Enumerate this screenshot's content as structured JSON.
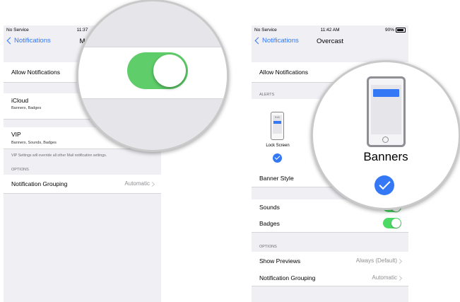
{
  "left": {
    "status": {
      "carrier": "No Service",
      "time": "11:37"
    },
    "nav": {
      "back_label": "Notifications",
      "title": "M"
    },
    "rows": {
      "allow_notifications": "Allow Notifications",
      "icloud": {
        "label": "iCloud",
        "sub": "Banners, Badges"
      },
      "vip": {
        "label": "VIP",
        "sub": "Banners, Sounds, Badges"
      },
      "footer": "VIP Settings will override all other Mail notification settings.",
      "options_header": "OPTIONS",
      "notification_grouping": {
        "label": "Notification Grouping",
        "value": "Automatic"
      }
    },
    "magnifier": {
      "allow_notifications_on": true
    }
  },
  "right": {
    "status": {
      "carrier": "No Service",
      "time": "11:42 AM",
      "battery": "90%"
    },
    "nav": {
      "back_label": "Notifications",
      "title": "Overcast"
    },
    "rows": {
      "allow_notifications": "Allow Notifications",
      "alerts_header": "ALERTS",
      "lock_screen": {
        "caption": "Lock Screen",
        "time": "9:41",
        "selected": true
      },
      "banner_style": "Banner Style",
      "sounds": {
        "label": "Sounds",
        "on": true
      },
      "badges": {
        "label": "Badges",
        "on": true
      },
      "options_header": "OPTIONS",
      "show_previews": {
        "label": "Show Previews",
        "value": "Always (Default)"
      },
      "notification_grouping": {
        "label": "Notification Grouping",
        "value": "Automatic"
      }
    },
    "magnifier": {
      "caption": "Banners",
      "selected": true
    }
  },
  "colors": {
    "ios_blue": "#3478f6",
    "toggle_green": "#4cd964",
    "background": "#efeff4"
  }
}
